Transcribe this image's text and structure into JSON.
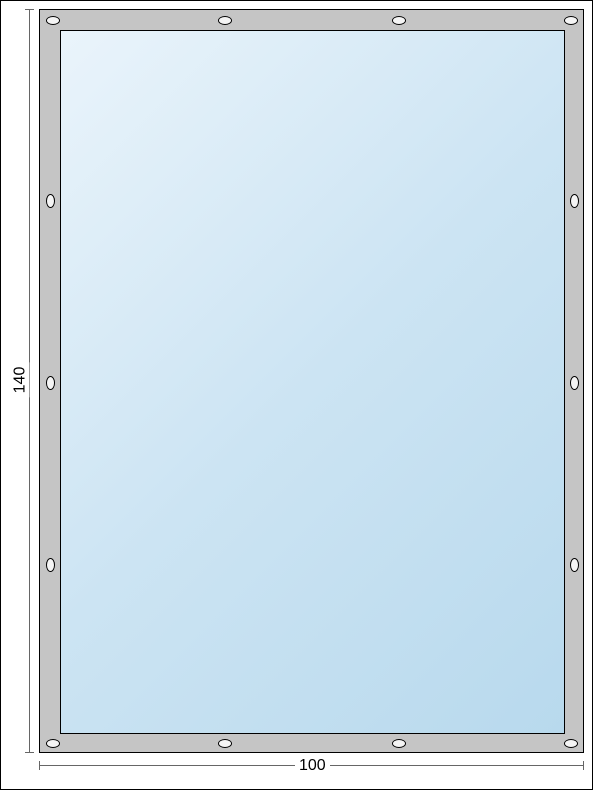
{
  "dimensions": {
    "width_label": "100",
    "height_label": "140"
  },
  "panel": {
    "frame_color": "#c5c5c5",
    "glass_gradient_start": "#eaf4fb",
    "glass_gradient_end": "#b8d9ed"
  },
  "grommets": {
    "top_count": 4,
    "bottom_count": 4,
    "left_count": 3,
    "right_count": 3
  }
}
